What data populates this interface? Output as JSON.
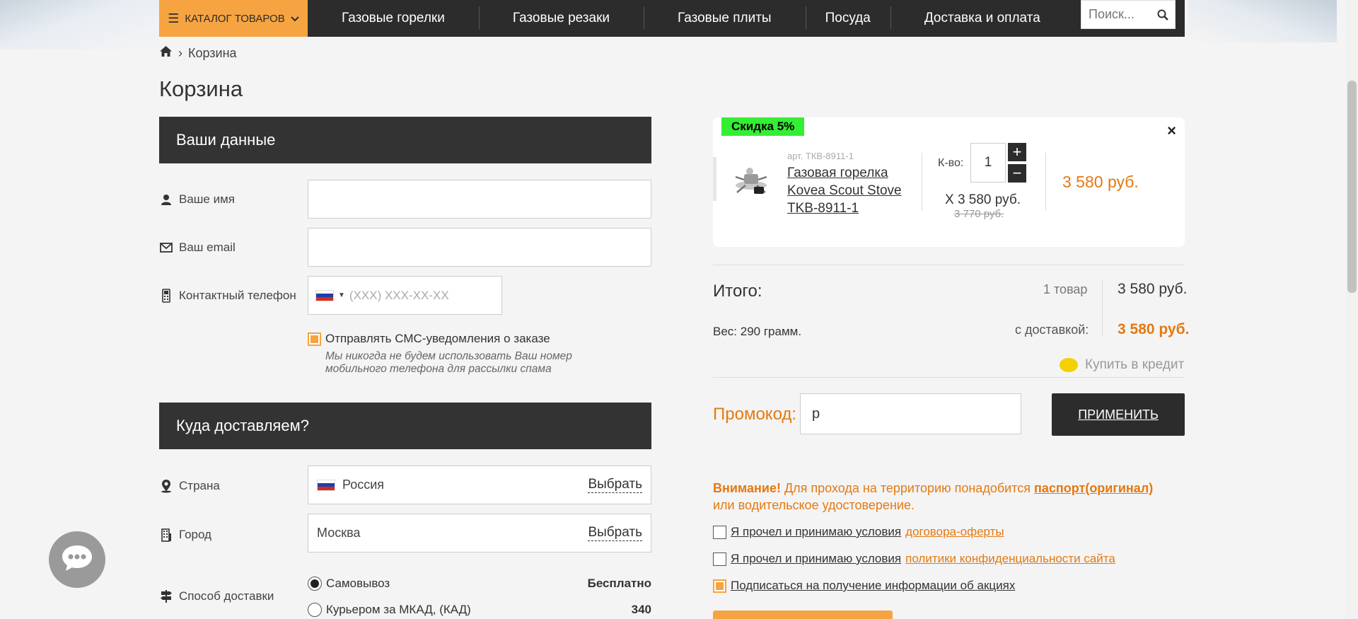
{
  "nav": {
    "catalog_label": "КАТАЛОГ ТОВАРОВ",
    "items": [
      "Газовые горелки",
      "Газовые резаки",
      "Газовые плиты",
      "Посуда",
      "Доставка и оплата"
    ],
    "search_placeholder": "Поиск..."
  },
  "breadcrumb": {
    "current": "Корзина"
  },
  "page_title": "Корзина",
  "your_data": {
    "heading": "Ваши данные",
    "name_label": "Ваше имя",
    "email_label": "Ваш email",
    "phone_label": "Контактный телефон",
    "phone_placeholder": "(XXX) XXX-XX-XX",
    "sms_label": "Отправлять СМС-уведомления о заказе",
    "sms_note": "Мы никогда не будем использовать Ваш номер мобильного телефона для рассылки спама"
  },
  "delivery": {
    "heading": "Куда доставляем?",
    "country_label": "Страна",
    "country_value": "Россия",
    "city_label": "Город",
    "city_value": "Москва",
    "choose_label": "Выбрать",
    "method_label": "Способ доставки",
    "options": [
      {
        "label": "Самовывоз",
        "price": "Бесплатно",
        "selected": true
      },
      {
        "label": "Курьером за МКАД, (КАД)",
        "price": "340",
        "selected": false
      }
    ]
  },
  "cart": {
    "discount_badge": "Скидка 5%",
    "close": "×",
    "article": "арт. ТКВ-8911-1",
    "product_name": "Газовая горелка Kovea Scout Stove TKB-8911-1",
    "qty_label": "К-во:",
    "qty": "1",
    "plus": "+",
    "minus": "−",
    "unit_price": "X 3 580 руб.",
    "old_price": "3 770 руб.",
    "total": "3 580 руб."
  },
  "summary": {
    "itogo": "Итого:",
    "items_count": "1 товар",
    "sum": "3 580 руб.",
    "weight_label": "Вес:",
    "weight_value": "290 грамм.",
    "with_delivery_label": "с доставкой:",
    "sum_with_delivery": "3 580 руб.",
    "credit_label": "Купить в кредит"
  },
  "promo": {
    "label": "Промокод:",
    "value": "р",
    "apply_label": "ПРИМЕНИТЬ"
  },
  "notice": {
    "attention": "Внимание!",
    "text": " Для прохода на территорию понадобится ",
    "passport": "паспорт(оригинал)",
    "text2": " или водительское удостоверение."
  },
  "agreements": [
    {
      "text": "Я прочел и принимаю условия ",
      "link": "договора-оферты",
      "checked": false
    },
    {
      "text": "Я прочел и принимаю условия ",
      "link": "политики конфиденциальности сайта",
      "checked": false
    },
    {
      "text": "Подписаться на получение информации об акциях",
      "link": "",
      "checked": true
    }
  ],
  "colors": {
    "accent": "#f5a441",
    "price": "#e47911",
    "dark": "#2c2c2c",
    "badge": "#33ee33"
  }
}
